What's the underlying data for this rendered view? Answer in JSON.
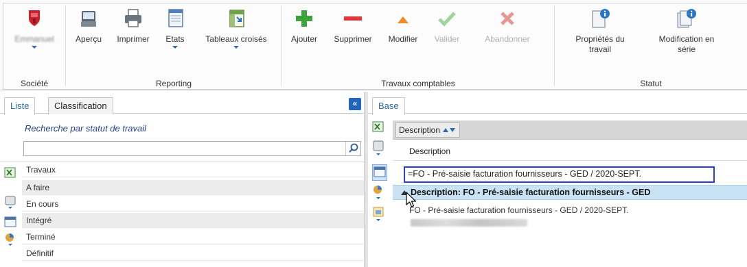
{
  "ribbon": {
    "groups": [
      {
        "label": "Société"
      },
      {
        "label": "Reporting"
      },
      {
        "label": "Travaux comptables"
      },
      {
        "label": "Statut"
      }
    ],
    "societe_button": {
      "label": "Emmanuel"
    },
    "buttons": {
      "apercu": "Aperçu",
      "imprimer": "Imprimer",
      "etats": "Etats",
      "tableaux": "Tableaux croisés",
      "ajouter": "Ajouter",
      "supprimer": "Supprimer",
      "modifier": "Modifier",
      "valider": "Valider",
      "abandonner": "Abandonner",
      "proprietes": "Propriétés du travail",
      "modification": "Modification en série"
    }
  },
  "left": {
    "tabs": [
      "Liste",
      "Classification"
    ],
    "collapse": "«",
    "search_title": "Recherche par statut de travail",
    "search_value": "",
    "rows": [
      "Travaux",
      "A faire",
      "En cours",
      "Intégré",
      "Terminé",
      "Définitif"
    ]
  },
  "right": {
    "tabs": [
      "Base"
    ],
    "group_chip": "Description",
    "column_header": "Description",
    "filter_value": "=FO - Pré-saisie facturation fournisseurs - GED / 2020-SEPT.",
    "group_row": "Description: FO - Pré-saisie facturation fournisseurs - GED",
    "data_row": "FO - Pré-saisie facturation fournisseurs - GED / 2020-SEPT."
  },
  "colors": {
    "accent": "#2b6aa8",
    "selection": "#c9e3f5",
    "filter_border": "#2a3fd1"
  }
}
